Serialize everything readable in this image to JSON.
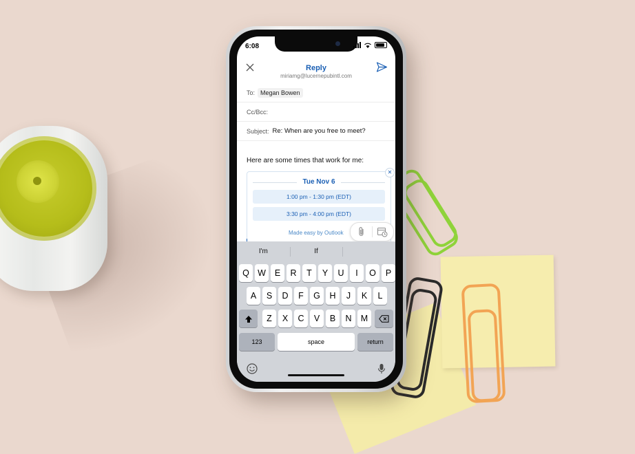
{
  "status_bar": {
    "time": "6:08",
    "icons": [
      "location-arrow-icon",
      "signal-icon",
      "wifi-icon",
      "battery-icon"
    ]
  },
  "compose": {
    "title": "Reply",
    "account": "miriamg@lucernepubintl.com",
    "to_label": "To:",
    "to_recipient": "Megan Bowen",
    "cc_label": "Cc/Bcc:",
    "subject_label": "Subject:",
    "subject_value": "Re: When are you free to meet?",
    "body": "Here are some times that work for me:"
  },
  "availability": {
    "date": "Tue Nov 6",
    "slots": [
      "1:00 pm - 1:30 pm (EDT)",
      "3:30 pm - 4:00 pm (EDT)"
    ],
    "footer": "Made easy by Outlook"
  },
  "keyboard": {
    "suggestions": [
      "I'm",
      "If",
      ""
    ],
    "row1": [
      "Q",
      "W",
      "E",
      "R",
      "T",
      "Y",
      "U",
      "I",
      "O",
      "P"
    ],
    "row2": [
      "A",
      "S",
      "D",
      "F",
      "G",
      "H",
      "J",
      "K",
      "L"
    ],
    "row3": [
      "Z",
      "X",
      "C",
      "V",
      "B",
      "N",
      "M"
    ],
    "numbers_key": "123",
    "space_key": "space",
    "return_key": "return"
  },
  "colors": {
    "accent": "#1a5fb4",
    "slot_bg": "#e6f0fa",
    "keyboard_bg": "#d1d4d9",
    "backdrop": "#ead8ce"
  }
}
